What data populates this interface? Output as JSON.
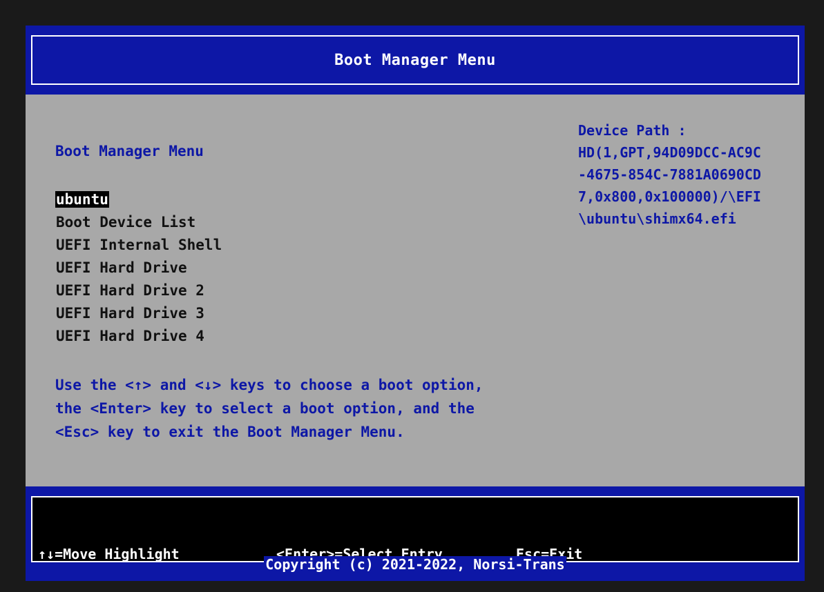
{
  "header": {
    "title": "Boot Manager Menu"
  },
  "main": {
    "menu_title": "Boot Manager Menu",
    "boot_options": [
      "ubuntu",
      "Boot Device List",
      "UEFI Internal Shell",
      "UEFI Hard Drive",
      "UEFI Hard Drive 2",
      "UEFI Hard Drive 3",
      "UEFI Hard Drive 4"
    ],
    "selected_option": "ubuntu",
    "help_lines": [
      "Use the <↑> and <↓> keys to choose a boot option,",
      "the <Enter> key to select a boot option, and the",
      "<Esc> key to exit the Boot Manager Menu."
    ]
  },
  "device_path": {
    "lines": [
      "Device Path :",
      "HD(1,GPT,94D09DCC-AC9C",
      "-4675-854C-7881A0690CD",
      "7,0x800,0x100000)/\\EFI",
      "\\ubuntu\\shimx64.efi"
    ]
  },
  "footer": {
    "move_hint": "↑↓=Move Highlight",
    "enter_hint": "<Enter>=Select Entry",
    "esc_hint": "Esc=Exit",
    "copyright": "Copyright (c) 2021-2022, Norsi-Trans"
  },
  "colors": {
    "panel_gray": "#a8a8a8",
    "bios_blue": "#0d17a6",
    "highlight_black": "#000000",
    "text_white": "#ffffff"
  }
}
